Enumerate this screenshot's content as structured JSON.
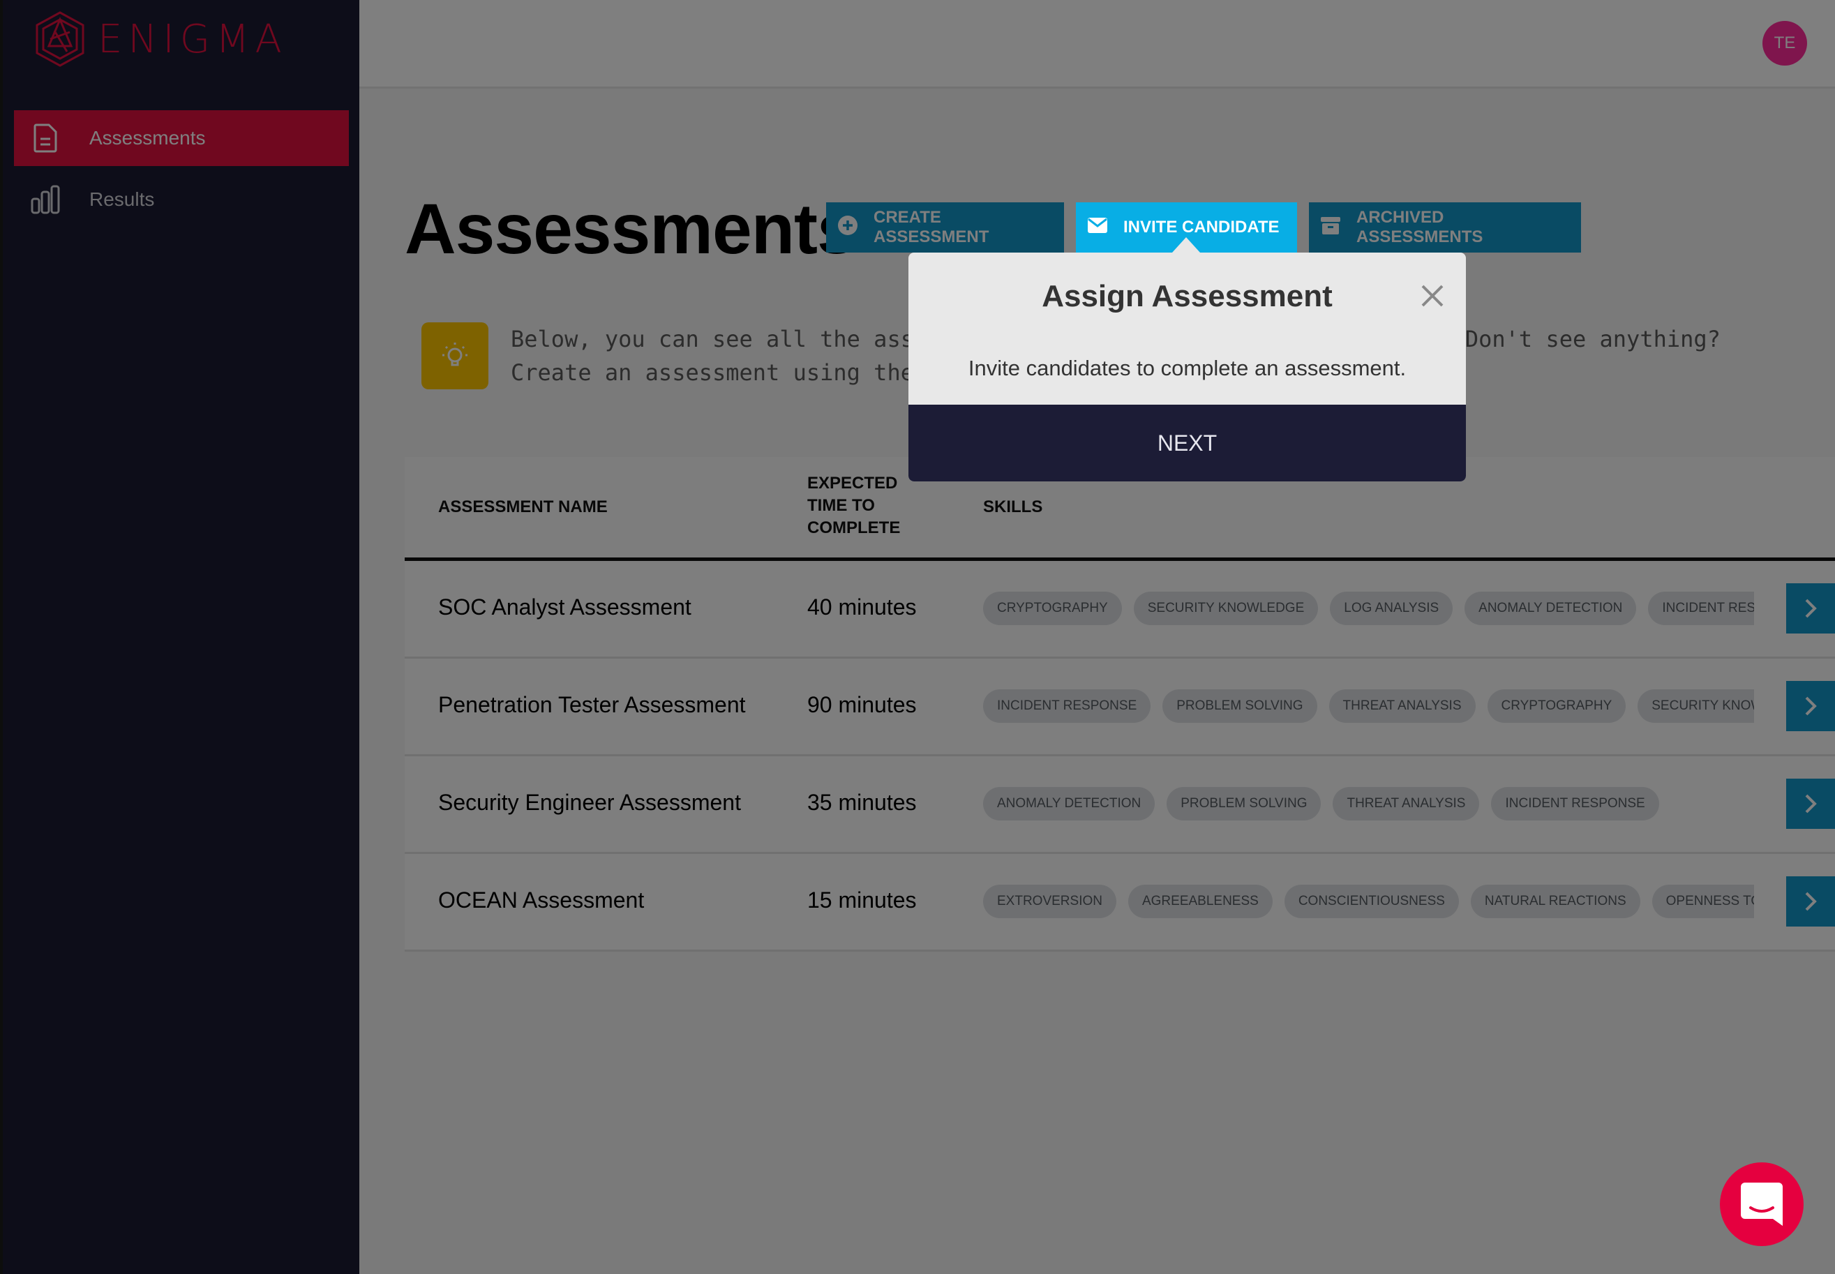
{
  "brand": {
    "name": "ENIGMA",
    "accent": "#e0103f"
  },
  "sidebar": {
    "items": [
      {
        "label": "Assessments",
        "icon": "document-icon",
        "active": true
      },
      {
        "label": "Results",
        "icon": "bar-chart-icon",
        "active": false
      }
    ]
  },
  "header": {
    "avatar_initials": "TE"
  },
  "page": {
    "title": "Assessments",
    "buttons": [
      {
        "label": "CREATE ASSESSMENT",
        "icon": "plus-circle-icon"
      },
      {
        "label": "INVITE CANDIDATE",
        "icon": "envelope-icon"
      },
      {
        "label": "ARCHIVED ASSESSMENTS",
        "icon": "archive-box-icon"
      }
    ],
    "info_text": "Below, you can see all the assessments available to your organization. Don't see anything? Create an assessment using the button above.",
    "info_line1_visible": "Below, you can see all the ass",
    "info_line1_right": "see anything? Create an",
    "info_line2_visible": "assessment using the button ab"
  },
  "table": {
    "headers": [
      "ASSESSMENT NAME",
      "EXPECTED TIME TO COMPLETE",
      "SKILLS"
    ],
    "header_time_lines": [
      "EXPECTED",
      "TIME TO",
      "COMPLETE"
    ],
    "rows": [
      {
        "name": "SOC Analyst Assessment",
        "time": "40 minutes",
        "skills": [
          "CRYPTOGRAPHY",
          "SECURITY KNOWLEDGE",
          "LOG ANALYSIS",
          "ANOMALY DETECTION",
          "INCIDENT RESPONSE"
        ]
      },
      {
        "name": "Penetration Tester Assessment",
        "time": "90 minutes",
        "skills": [
          "INCIDENT RESPONSE",
          "PROBLEM SOLVING",
          "THREAT ANALYSIS",
          "CRYPTOGRAPHY",
          "SECURITY KNOWLEDGE"
        ]
      },
      {
        "name": "Security Engineer Assessment",
        "time": "35 minutes",
        "skills": [
          "ANOMALY DETECTION",
          "PROBLEM SOLVING",
          "THREAT ANALYSIS",
          "INCIDENT RESPONSE"
        ]
      },
      {
        "name": "OCEAN Assessment",
        "time": "15 minutes",
        "skills": [
          "EXTROVERSION",
          "AGREEABLENESS",
          "CONSCIENTIOUSNESS",
          "NATURAL REACTIONS",
          "OPENNESS TO EXPERIENCE"
        ]
      }
    ]
  },
  "popover": {
    "title": "Assign Assessment",
    "body": "Invite candidates to complete an assessment.",
    "next_label": "NEXT",
    "close_icon": "close-icon"
  },
  "chat_widget": {
    "icon": "chat-bubble-icon"
  }
}
